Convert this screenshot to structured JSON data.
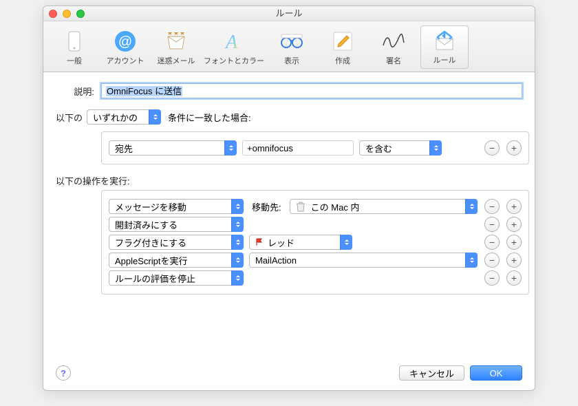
{
  "window": {
    "title": "ルール"
  },
  "toolbar": {
    "items": [
      {
        "label": "一般"
      },
      {
        "label": "アカウント"
      },
      {
        "label": "迷惑メール"
      },
      {
        "label": "フォントとカラー"
      },
      {
        "label": "表示"
      },
      {
        "label": "作成"
      },
      {
        "label": "署名"
      },
      {
        "label": "ルール"
      }
    ]
  },
  "description": {
    "label": "説明:",
    "value": "OmniFocus に送信"
  },
  "conditions": {
    "prefix": "以下の",
    "any_all": "いずれかの",
    "suffix": "条件に一致した場合:",
    "rows": [
      {
        "header": "宛先",
        "value": "+omnifocus",
        "op": "を含む"
      }
    ]
  },
  "actions": {
    "label": "以下の操作を実行:",
    "rows": [
      {
        "kind": "popup-with-dest",
        "action": "メッセージを移動",
        "dest_label": "移動先:",
        "dest_value": "この Mac 内"
      },
      {
        "kind": "popup-only",
        "action": "開封済みにする"
      },
      {
        "kind": "popup-with-flag",
        "action": "フラグ付きにする",
        "flag_label": "レッド",
        "flag_color": "#ff3b30"
      },
      {
        "kind": "popup-with-script",
        "action": "AppleScriptを実行",
        "script": "MailAction"
      },
      {
        "kind": "popup-only",
        "action": "ルールの評価を停止"
      }
    ]
  },
  "footer": {
    "cancel": "キャンセル",
    "ok": "OK"
  }
}
